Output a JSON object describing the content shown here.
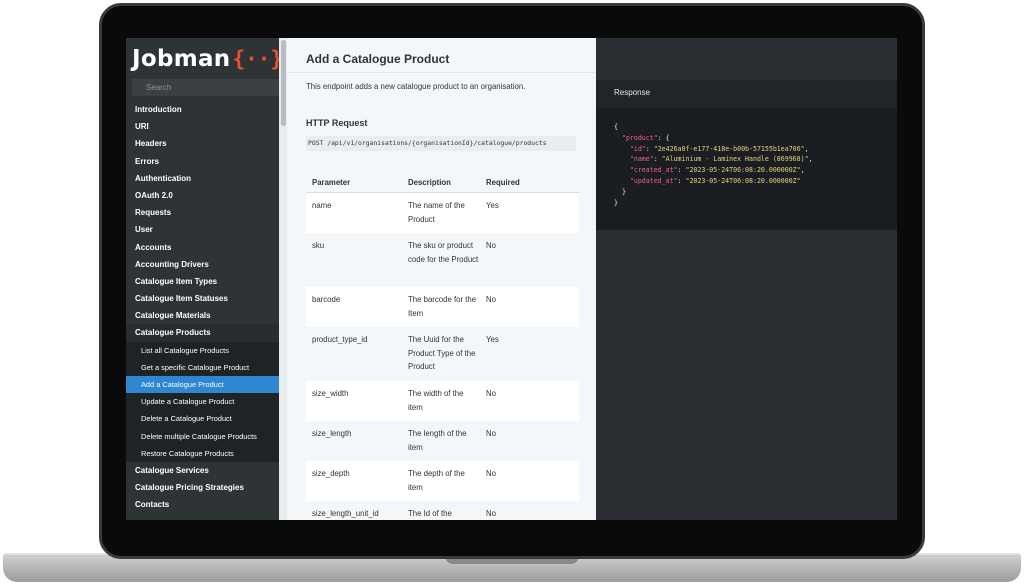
{
  "brand": {
    "name": "Jobman",
    "brace": "{··}",
    "accent": "#e8512f"
  },
  "sidebar": {
    "search_placeholder": "Search",
    "items": [
      {
        "label": "Introduction"
      },
      {
        "label": "URI"
      },
      {
        "label": "Headers"
      },
      {
        "label": "Errors"
      },
      {
        "label": "Authentication"
      },
      {
        "label": "OAuth 2.0"
      },
      {
        "label": "Requests"
      },
      {
        "label": "User"
      },
      {
        "label": "Accounts"
      },
      {
        "label": "Accounting Drivers"
      },
      {
        "label": "Catalogue Item Types"
      },
      {
        "label": "Catalogue Item Statuses"
      },
      {
        "label": "Catalogue Materials"
      },
      {
        "label": "Catalogue Products"
      }
    ],
    "sub_items": [
      {
        "label": "List all Catalogue Products"
      },
      {
        "label": "Get a specific Catalogue Product"
      },
      {
        "label": "Add a Catalogue Product"
      },
      {
        "label": "Update a Catalogue Product"
      },
      {
        "label": "Delete a Catalogue Product"
      },
      {
        "label": "Delete multiple Catalogue Products"
      },
      {
        "label": "Restore Catalogue Products"
      }
    ],
    "items_after": [
      {
        "label": "Catalogue Services"
      },
      {
        "label": "Catalogue Pricing Strategies"
      },
      {
        "label": "Contacts"
      }
    ],
    "active_color": "#2f86d1"
  },
  "main": {
    "title": "Add a Catalogue Product",
    "intro": "This endpoint adds a new catalogue product to an organisation.",
    "http_heading": "HTTP Request",
    "endpoint": "POST /api/v1/organisations/{organisationId}/catalogue/products",
    "table": {
      "headers": [
        "Parameter",
        "Description",
        "Required"
      ],
      "rows": [
        {
          "param": "name",
          "desc": "The name of the Product",
          "req": "Yes"
        },
        {
          "param": "sku",
          "desc": "The sku or product code for the Product",
          "req": "No"
        },
        {
          "param": "barcode",
          "desc": "The barcode for the Item",
          "req": "No"
        },
        {
          "param": "product_type_id",
          "desc": "The Uuid for the Product Type of the Product",
          "req": "Yes"
        },
        {
          "param": "size_width",
          "desc": "The width of the item",
          "req": "No"
        },
        {
          "param": "size_length",
          "desc": "The length of the item",
          "req": "No"
        },
        {
          "param": "size_depth",
          "desc": "The depth of the item",
          "req": "No"
        },
        {
          "param": "size_length_unit_id",
          "desc": "The Id of the",
          "req": "No"
        }
      ]
    }
  },
  "response": {
    "label": "Response",
    "json": {
      "root_key": "\"product\"",
      "id_key": "\"id\"",
      "id_val": "\"2e426a0f-e177-418e-b00b-57155b1ea706\"",
      "name_key": "\"name\"",
      "name_val": "\"Aluminium - Laminex Handle (869968)\"",
      "created_key": "\"created_at\"",
      "created_val": "\"2023-05-24T06:08:20.000000Z\"",
      "updated_key": "\"updated_at\"",
      "updated_val": "\"2023-05-24T06:08:20.000000Z\""
    }
  }
}
